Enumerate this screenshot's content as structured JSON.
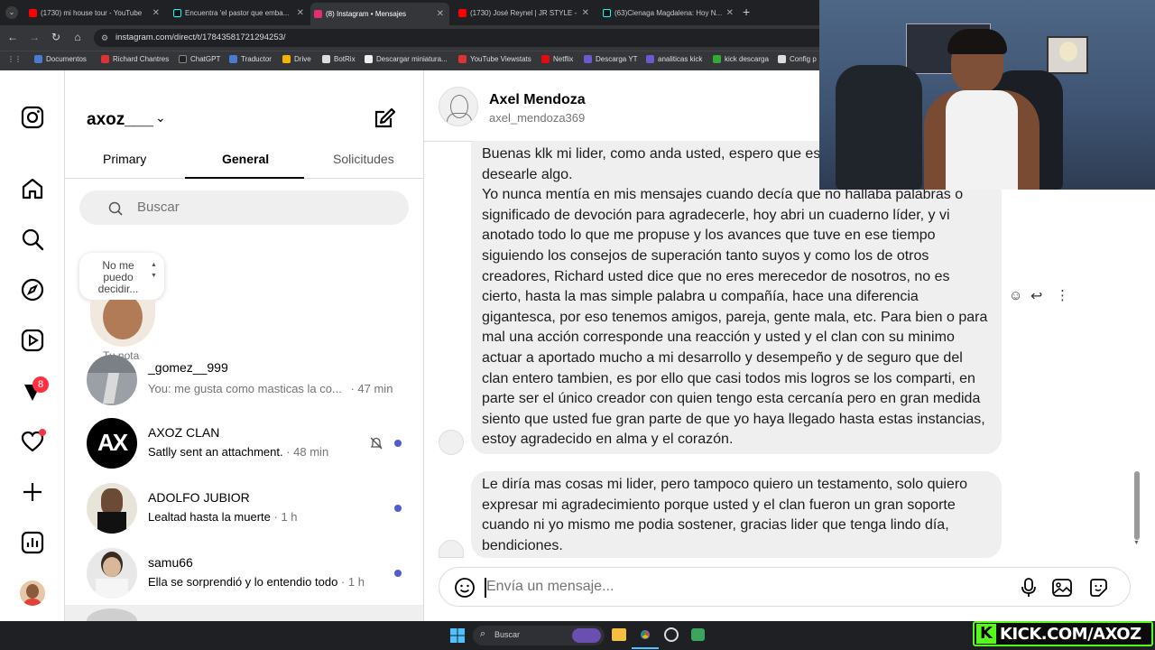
{
  "browser": {
    "tabs": [
      {
        "title": "(1730) mi house tour - YouTube",
        "color": "#ff0000"
      },
      {
        "title": "Encuentra 'el pastor que emba...",
        "color": "#111111"
      },
      {
        "title": "(8) Instagram • Mensajes",
        "color": "#e1306c"
      },
      {
        "title": "(1730) José Reynel | JR STYLE -",
        "color": "#ff0000"
      },
      {
        "title": "(63)Cienaga Magdalena: Hoy N...",
        "color": "#111111"
      }
    ],
    "new_tab": "+",
    "url": "instagram.com/direct/t/17843581721294253/",
    "bookmarks": [
      {
        "label": "Documentos",
        "color": "#4a7bd0"
      },
      {
        "label": "Richard Chantres",
        "color": "#d33"
      },
      {
        "label": "ChatGPT",
        "color": "#222"
      },
      {
        "label": "Traductor",
        "color": "#4a7bd0"
      },
      {
        "label": "Drive",
        "color": "#f4b400"
      },
      {
        "label": "BotRix",
        "color": "#ddd"
      },
      {
        "label": "Descargar miniatura...",
        "color": "#eee"
      },
      {
        "label": "YouTube Viewstats",
        "color": "#d33"
      },
      {
        "label": "Netflix",
        "color": "#e50914"
      },
      {
        "label": "Descarga YT",
        "color": "#6a5acd"
      },
      {
        "label": "analiticas kick",
        "color": "#6a5acd"
      },
      {
        "label": "kick descarga",
        "color": "#3a3"
      },
      {
        "label": "Config p",
        "color": "#ddd"
      }
    ]
  },
  "sidebar": {
    "notif_count": "8"
  },
  "inbox": {
    "username": "axoz___",
    "tabs": [
      "Primary",
      "General",
      "Solicitudes"
    ],
    "active_tab": "General",
    "search_placeholder": "Buscar",
    "note": {
      "text": "No me puedo decidir...",
      "label": "Tu nota"
    },
    "conversations": [
      {
        "name": "_gomez__999",
        "message": "You: me gusta como masticas la co...",
        "time": "· 47 min",
        "unread": false,
        "muted": false
      },
      {
        "name": "AXOZ CLAN",
        "message": "Satlly sent an attachment.",
        "time": "· 48 min",
        "unread": true,
        "muted": true
      },
      {
        "name": "ADOLFO JUBIOR",
        "message": "Lealtad hasta la muerte",
        "time": "· 1 h",
        "unread": true,
        "muted": false
      },
      {
        "name": "samu66",
        "message": "Ella se sorprendió y lo entendio todo",
        "time": "· 1 h",
        "unread": true,
        "muted": false
      }
    ]
  },
  "chat": {
    "contact_name": "Axel Mendoza",
    "contact_handle": "axel_mendoza369",
    "messages": [
      {
        "text": "Buenas klk mi lider, como anda usted, espero que este bien, escribo para desearle algo.\nYo nunca mentía en mis mensajes cuando decía que no hallaba palabras o significado de devoción para agradecerle, hoy abri un cuaderno líder, y vi anotado todo lo que me propuse y los avances que tuve en ese tiempo siguiendo los consejos de superación tanto suyos y como los de otros creadores, Richard usted dice que no eres merecedor de nosotros, no es cierto, hasta la mas simple palabra u compañía, hace una diferencia gigantesca, por eso tenemos amigos, pareja, gente mala, etc. Para bien o para mal una acción corresponde una reacción y usted y el clan con su minimo actuar a aportado mucho a mi desarrollo y desempeño y de seguro que del clan entero tambien, es por ello que casi todos mis logros se los comparti, en parte ser el único creador con quien tengo esta cercanía pero en gran medida siento que usted fue gran parte de que yo haya llegado hasta estas instancias, estoy agradecido en alma y el corazón."
      },
      {
        "text": "Le diría mas cosas mi lider, pero tampoco quiero un testamento, solo quiero expresar mi agradecimiento porque usted y el clan fueron un gran soporte cuando ni yo mismo me podia sostener, gracias lider que tenga lindo día, bendiciones."
      }
    ],
    "input_placeholder": "Envía un mensaje..."
  },
  "taskbar": {
    "search_placeholder": "Buscar"
  },
  "overlay": {
    "kick_text": "KICK.COM/AXOZ"
  }
}
